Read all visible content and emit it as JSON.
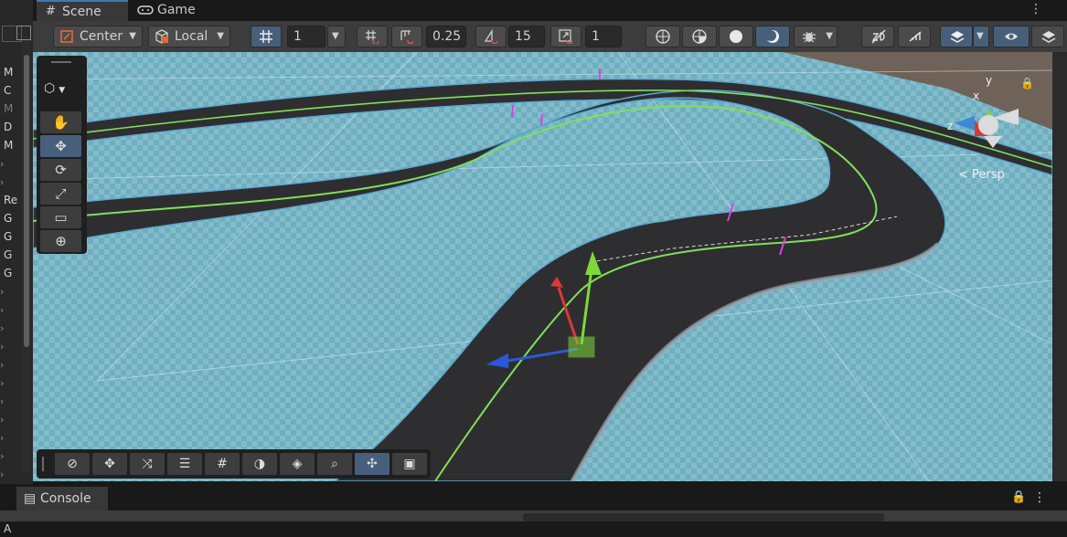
{
  "hierarchy": {
    "rows": [
      {
        "label": "M",
        "dim": false,
        "chevron": false
      },
      {
        "label": "C",
        "dim": false,
        "chevron": false
      },
      {
        "label": "M",
        "dim": true,
        "chevron": false
      },
      {
        "label": "D",
        "dim": false,
        "chevron": false
      },
      {
        "label": "M",
        "dim": false,
        "chevron": false
      },
      {
        "label": "",
        "dim": false,
        "chevron": true
      },
      {
        "label": "",
        "dim": false,
        "chevron": true
      },
      {
        "label": "Re",
        "dim": false,
        "chevron": false
      },
      {
        "label": "G",
        "dim": false,
        "chevron": false
      },
      {
        "label": "G",
        "dim": false,
        "chevron": false
      },
      {
        "label": "G",
        "dim": false,
        "chevron": false
      },
      {
        "label": "G",
        "dim": false,
        "chevron": false
      },
      {
        "label": "",
        "dim": false,
        "chevron": true
      },
      {
        "label": "",
        "dim": false,
        "chevron": true
      },
      {
        "label": "",
        "dim": false,
        "chevron": true
      },
      {
        "label": "",
        "dim": false,
        "chevron": true
      },
      {
        "label": "",
        "dim": false,
        "chevron": true
      },
      {
        "label": "",
        "dim": false,
        "chevron": true
      },
      {
        "label": "",
        "dim": false,
        "chevron": true
      },
      {
        "label": "",
        "dim": false,
        "chevron": true
      },
      {
        "label": "",
        "dim": false,
        "chevron": true
      },
      {
        "label": "",
        "dim": false,
        "chevron": true
      },
      {
        "label": "",
        "dim": false,
        "chevron": true
      },
      {
        "label": "",
        "dim": false,
        "chevron": true
      },
      {
        "label": "",
        "dim": false,
        "chevron": true
      },
      {
        "label": "A",
        "dim": false,
        "chevron": false
      }
    ]
  },
  "tabs": {
    "scene": "Scene",
    "game": "Game"
  },
  "toolbar": {
    "pivot_mode": "Center",
    "pivot_rotation": "Local",
    "grid_size": "1",
    "snap_increment": "0.25",
    "rotation_snap": "15",
    "scale_snap": "1"
  },
  "scene": {
    "projection_label": "Persp",
    "gizmo_axes": {
      "x": "x",
      "y": "y",
      "z": "z"
    }
  },
  "console": {
    "tab_label": "Console"
  },
  "colors": {
    "accent": "#46607c",
    "track": "#2e2e30",
    "ground": "#7cb6c6",
    "spline": "#7fe05a",
    "marker": "#e040e0"
  }
}
